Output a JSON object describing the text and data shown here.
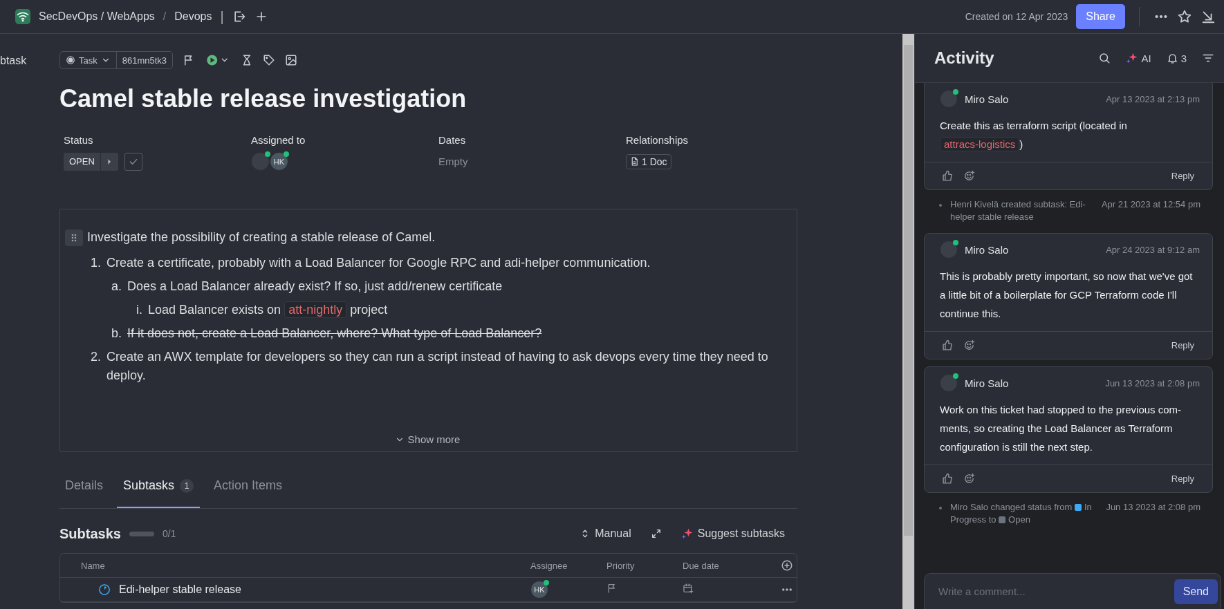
{
  "topbar": {
    "breadcrumb": "SecDevOps / WebApps",
    "separator": "/",
    "location": "Devops",
    "divider": "|",
    "created": "Created on 12 Apr 2023",
    "share": "Share"
  },
  "side_text": "btask",
  "task": {
    "type": "Task",
    "id": "861mn5tk3",
    "title": "Camel stable release investigation"
  },
  "fields": [
    {
      "label": "Status",
      "kind": "status",
      "value": "OPEN"
    },
    {
      "label": "Assigned to",
      "kind": "assignees",
      "people": [
        {
          "photo": true,
          "online": true
        },
        {
          "initials": "HK",
          "photo": false,
          "online": true
        }
      ]
    },
    {
      "label": "Dates",
      "kind": "text",
      "value": "Empty"
    },
    {
      "label": "Relationships",
      "kind": "doc",
      "value": "1 Doc"
    }
  ],
  "description": {
    "intro": "Investigate the possibility of creating a stable release of Camel.",
    "items": [
      {
        "marker": "1.",
        "struck": false,
        "parts": [
          {
            "kind": "text",
            "text": "Create a certificate, probably with a Load Balancer for Google RPC and adi-helper communication."
          }
        ],
        "children": [
          {
            "marker": "a.",
            "struck": false,
            "parts": [
              {
                "kind": "text",
                "text": "Does a Load Balancer already exist? If so, just add/renew certificate"
              }
            ],
            "children": [
              {
                "marker": "i.",
                "struck": false,
                "parts": [
                  {
                    "kind": "text",
                    "text": "Load Balancer exists on "
                  },
                  {
                    "kind": "code",
                    "text": "att-nightly"
                  },
                  {
                    "kind": "text",
                    "text": " project"
                  }
                ]
              }
            ]
          },
          {
            "marker": "b.",
            "struck": true,
            "parts": [
              {
                "kind": "text",
                "text": "If it does not, create a Load Balancer, where? What type of Load Balancer?"
              }
            ]
          }
        ]
      },
      {
        "marker": "2.",
        "struck": false,
        "parts": [
          {
            "kind": "text",
            "text": "Create an AWX template for developers so they can run a script instead of having to ask devops every time they need to deploy."
          }
        ]
      }
    ],
    "show_more": "Show more"
  },
  "tabs": [
    {
      "label": "Details",
      "selected": false
    },
    {
      "label": "Subtasks",
      "count": "1",
      "selected": true
    },
    {
      "label": "Action Items",
      "selected": false
    }
  ],
  "subtasks": {
    "title": "Subtasks",
    "level": 0,
    "progress": "0/1",
    "sort": "Manual",
    "suggest": "Suggest subtasks",
    "columns": [
      "Name",
      "Assignee",
      "Priority",
      "Due date"
    ],
    "rows": [
      {
        "name": "Edi-helper stable release",
        "assignee": "HK",
        "online": true
      }
    ]
  },
  "activity": {
    "title": "Activity",
    "ai": "AI",
    "notifications": "3",
    "items": [
      {
        "kind": "comment",
        "author": "Miro Salo",
        "online": true,
        "time": "Apr 13 2023 at 2:13 pm",
        "parts": [
          {
            "kind": "text",
            "text": "Create this as terraform script (located in "
          },
          {
            "kind": "code",
            "text": "attracs-logistics"
          },
          {
            "kind": "text",
            "text": ")"
          }
        ],
        "reply": "Reply"
      },
      {
        "kind": "event",
        "parts": [
          {
            "kind": "text",
            "text": "Henri Kivelä created subtask: Edi-helper stable release"
          }
        ],
        "time": "Apr 21 2023 at 12:54 pm"
      },
      {
        "kind": "comment",
        "author": "Miro Salo",
        "online": true,
        "time": "Apr 24 2023 at 9:12 am",
        "parts": [
          {
            "kind": "text",
            "text": "This is probably pretty important, so now that we've got a little bit of a boilerplate for GCP Terraform code I'll continue this."
          }
        ],
        "reply": "Reply"
      },
      {
        "kind": "comment",
        "author": "Miro Salo",
        "online": true,
        "time": "Jun 13 2023 at 2:08 pm",
        "parts": [
          {
            "kind": "text",
            "text": "Work on this ticket had stopped to the previous com-ments, so creating the Load Balancer as Terraform configuration is still the next step."
          }
        ],
        "reply": "Reply"
      },
      {
        "kind": "event",
        "parts": [
          {
            "kind": "text",
            "text": "Miro Salo changed status from "
          },
          {
            "kind": "status",
            "text": "In Progress",
            "color": "#3fa9f5"
          },
          {
            "kind": "text",
            "text": " to "
          },
          {
            "kind": "status",
            "text": "Open",
            "color": "#6b7280"
          }
        ],
        "time": "Jun 13 2023 at 2:08 pm"
      }
    ],
    "comment": {
      "placeholder": "Write a comment...",
      "send": "Send"
    }
  }
}
